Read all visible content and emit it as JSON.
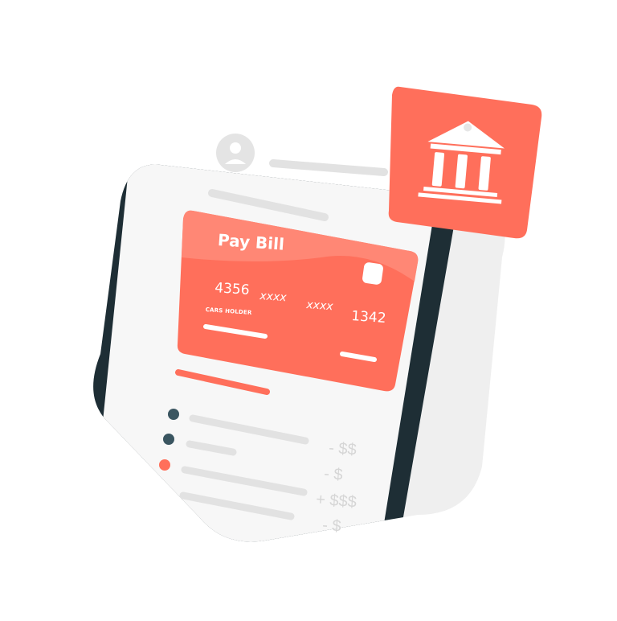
{
  "card": {
    "title": "Pay Bill",
    "number_parts": [
      "4356",
      "xxxx",
      "xxxx",
      "1342"
    ],
    "holder_label": "CARS HOLDER"
  },
  "transactions": {
    "amounts": [
      "- $$",
      "- $",
      "+ $$$",
      "- $"
    ]
  },
  "colors": {
    "accent": "#ff6f5b",
    "phone_frame": "#1e2e35",
    "screen_bg": "#f7f7f7",
    "placeholder_bar": "#e2e2e2",
    "dot_dark": "#3a5560",
    "backdrop": "#efefef"
  },
  "icons": [
    "user-avatar-icon",
    "bank-icon",
    "card-chip-icon"
  ]
}
